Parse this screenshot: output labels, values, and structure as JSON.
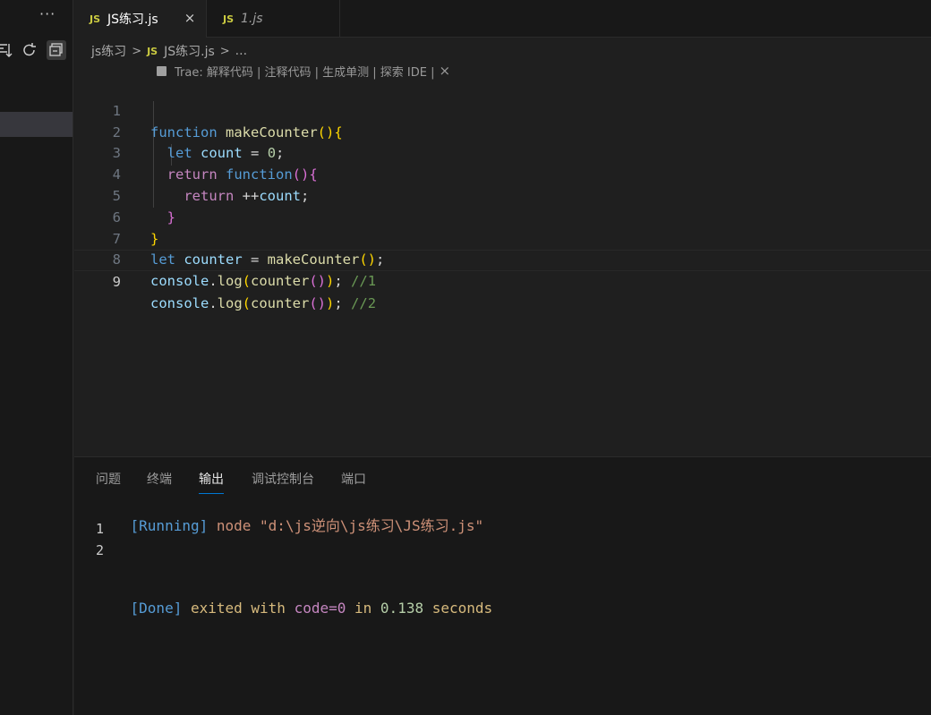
{
  "sidebar": {
    "more": "···"
  },
  "tabs": [
    {
      "badge": "JS",
      "label": "JS练习.js",
      "close": "×"
    },
    {
      "badge": "JS",
      "label": "1.js"
    }
  ],
  "breadcrumb": {
    "folder": "js练习",
    "sep": ">",
    "badge": "JS",
    "file": "JS练习.js",
    "tail": "..."
  },
  "codelens": {
    "text": "Trae: 解释代码 | 注释代码 | 生成单测 | 探索 IDE |",
    "close": "×"
  },
  "editor": {
    "line_numbers": [
      "1",
      "2",
      "3",
      "4",
      "5",
      "6",
      "7",
      "8",
      "9"
    ],
    "tokens": {
      "l1_kw": "function",
      "l1_fn": "makeCounter",
      "l1_b": "(){",
      "l2_kw": "let",
      "l2_var": "count",
      "l2_eq": " = ",
      "l2_num": "0",
      "l2_semi": ";",
      "l3_ctl": "return",
      "l3_kw": "function",
      "l3_b": "(){",
      "l4_ctl": "return",
      "l4_op": "++",
      "l4_var": "count",
      "l4_semi": ";",
      "l5_b": "}",
      "l6_b": "}",
      "l7_kw": "let",
      "l7_var": "counter",
      "l7_eq": " = ",
      "l7_fn": "makeCounter",
      "l7_b1": "()",
      "l7_semi": ";",
      "l8_obj": "console",
      "l8_dot": ".",
      "l8_fn": "log",
      "l8_p1": "(",
      "l8_fn2": "counter",
      "l8_p2": "()",
      "l8_p3": ")",
      "l8_semi": ";",
      "l8_cmt": "//1",
      "l9_obj": "console",
      "l9_dot": ".",
      "l9_fn": "log",
      "l9_p1": "(",
      "l9_fn2": "counter",
      "l9_p2": "()",
      "l9_p3": ")",
      "l9_semi": ";",
      "l9_cmt": "//2"
    }
  },
  "panel": {
    "tabs": [
      "问题",
      "终端",
      "输出",
      "调试控制台",
      "端口"
    ],
    "output": {
      "running_tag": "[Running]",
      "running_cmd": "node \"d:\\js逆向\\js练习\\JS练习.js\"",
      "line1": "1",
      "line2": "2",
      "done_tag": "[Done]",
      "done_exited": "exited with",
      "done_code": "code=0",
      "done_in": "in",
      "done_time": "0.138",
      "done_seconds": "seconds"
    }
  }
}
